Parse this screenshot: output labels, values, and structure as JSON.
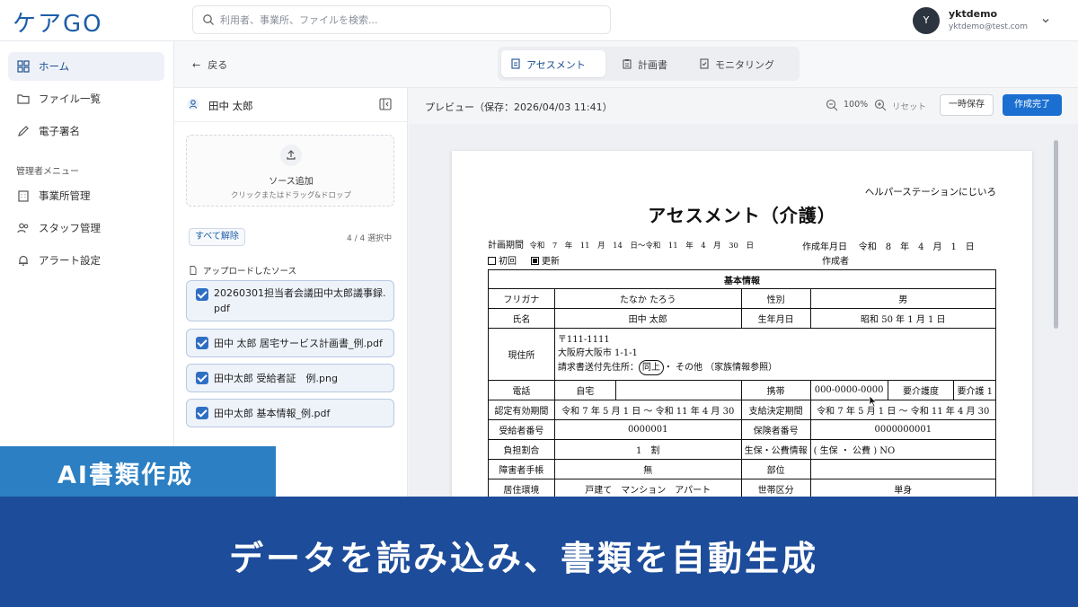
{
  "app": {
    "logo": "ケアGO"
  },
  "search": {
    "placeholder": "利用者、事業所、ファイルを検索..."
  },
  "user": {
    "initial": "Y",
    "name": "yktdemo",
    "email": "yktdemo@test.com"
  },
  "sidebar": {
    "items": [
      {
        "label": "ホーム",
        "icon": "grid-icon",
        "active": true
      },
      {
        "label": "ファイル一覧",
        "icon": "folder-icon"
      },
      {
        "label": "電子署名",
        "icon": "pen-icon"
      }
    ],
    "section_label": "管理者メニュー",
    "admin_items": [
      {
        "label": "事業所管理",
        "icon": "building-icon"
      },
      {
        "label": "スタッフ管理",
        "icon": "users-icon"
      },
      {
        "label": "アラート設定",
        "icon": "bell-icon"
      }
    ]
  },
  "subheader": {
    "back_label": "戻る",
    "tabs": [
      {
        "label": "アセスメント",
        "active": true
      },
      {
        "label": "計画書"
      },
      {
        "label": "モニタリング"
      }
    ]
  },
  "left_panel": {
    "person_name": "田中 太郎",
    "drop_title": "ソース追加",
    "drop_hint": "クリックまたはドラッグ&ドロップ",
    "clear_label": "すべて解除",
    "selected_count": "4 / 4 選択中",
    "sources_title": "アップロードしたソース",
    "sources": [
      "20260301担当者会議田中太郎議事録.pdf",
      "田中 太郎 居宅サービス計画書_例.pdf",
      "田中太郎 受給者証　例.png",
      "田中太郎 基本情報_例.pdf"
    ]
  },
  "preview": {
    "title": "プレビュー（保存：2026/04/03 11:41）",
    "zoom": "100%",
    "reset_label": "リセット",
    "save_label": "一時保存",
    "complete_label": "作成完了"
  },
  "document": {
    "org": "ヘルパーステーションにじいろ",
    "title": "アセスメント（介護）",
    "period_label": "計画期間",
    "period_value": "令和　7　年　11　月　14　日～令和　11　年　4　月　30　日",
    "created_label": "作成年月日",
    "created_value": "令和　8　年　4　月　1　日",
    "maker_label": "作成者",
    "check_first": "初回",
    "check_update": "更新",
    "section": "基本情報",
    "furigana_label": "フリガナ",
    "furigana": "たなか たろう",
    "gender_label": "性別",
    "gender": "男",
    "name_label": "氏名",
    "name": "田中 太郎",
    "birth_label": "生年月日",
    "birth": "昭和 50 年 1 月 1 日",
    "address_label": "現住所",
    "zip": "〒111-1111",
    "address": "大阪府大阪市 1-1-1",
    "bill_label": "請求書送付先住所：",
    "bill_same": "同上",
    "bill_other": "・ その他 （家族情報参照）",
    "phone_label": "電話",
    "home_label": "自宅",
    "mobile_label": "携帯",
    "mobile": "000-0000-0000",
    "care_label": "要介護度",
    "care": "要介護 1",
    "valid_label": "認定有効期間",
    "valid": "令和 7 年 5 月 1 日 ～ 令和 11 年 4 月 30",
    "decision_label": "支給決定期間",
    "decision": "令和 7 年 5 月 1 日 ～ 令和 11 年 4 月 30",
    "recipient_label": "受給者番号",
    "recipient": "0000001",
    "insurer_label": "保険者番号",
    "insurer": "0000000001",
    "burden_label": "負担割合",
    "burden": "1　割",
    "welfare_label": "生保・公費情報",
    "welfare": "( 生保 ・ 公費 ) NO",
    "disability_label": "障害者手帳",
    "disability": "無",
    "dept_label": "部位",
    "housing_label": "居住環境",
    "housing": "戸建て　マンション　アパート",
    "household_label": "世帯区分",
    "household": "単身"
  },
  "banner": {
    "tag": "AI書類作成",
    "caption": "データを読み込み、書類を自動生成"
  },
  "colors": {
    "brand": "#1d5fa8",
    "primary_button": "#1b6fd1",
    "banner": "#1d4c9a",
    "tag": "#2b7fc2"
  }
}
